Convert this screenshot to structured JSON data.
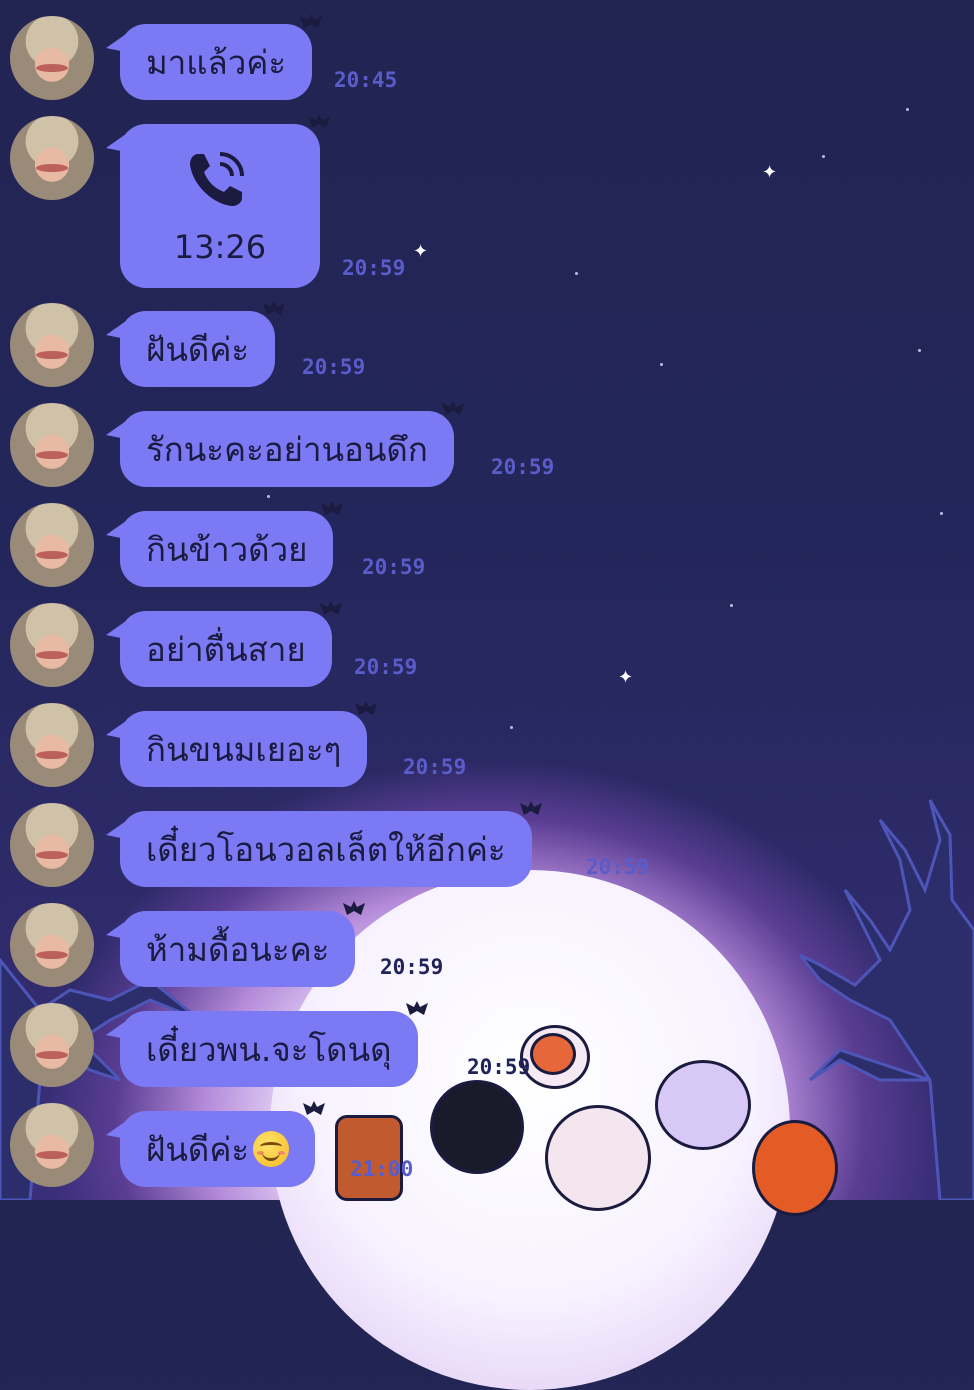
{
  "chat": {
    "messages": [
      {
        "type": "text",
        "text": "มาแล้วค่ะ",
        "time": "20:45"
      },
      {
        "type": "call",
        "duration": "13:26",
        "time": "20:59",
        "icon": "phone-call-icon"
      },
      {
        "type": "text",
        "text": "ฝันดีค่ะ",
        "time": "20:59"
      },
      {
        "type": "text",
        "text": "รักนะคะอย่านอนดึก",
        "time": "20:59"
      },
      {
        "type": "text",
        "text": "กินข้าวด้วย",
        "time": "20:59"
      },
      {
        "type": "text",
        "text": "อย่าตื่นสาย",
        "time": "20:59"
      },
      {
        "type": "text",
        "text": "กินขนมเยอะๆ",
        "time": "20:59"
      },
      {
        "type": "text",
        "text": "เดี๋ยวโอนวอลเล็ตให้อีกค่ะ",
        "time": "20:59"
      },
      {
        "type": "text",
        "text": "ห้ามดื้อนะคะ",
        "time": "20:59"
      },
      {
        "type": "text",
        "text": "เดี๋ยวพน.จะโดนดุ",
        "time": "20:59"
      },
      {
        "type": "text",
        "text": "ฝันดีค่ะ",
        "emoji": "smiling-face-icon",
        "time": "21:00"
      }
    ]
  },
  "colors": {
    "bubble": "#7b79f3",
    "background": "#23265a",
    "timestamp": "#5a5cc9"
  }
}
